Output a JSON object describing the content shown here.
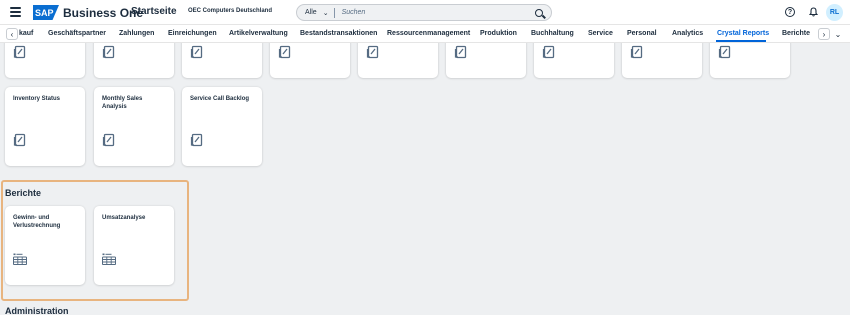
{
  "shell": {
    "logo": "SAP",
    "product": "Business One",
    "home_title": "Startseite",
    "company": "OEC Computers Deutschland",
    "search_scope": "Alle",
    "search_placeholder": "Suchen",
    "help_glyph": "?",
    "avatar": "RL"
  },
  "tabs": [
    {
      "label": "kauf"
    },
    {
      "label": "Geschäftspartner"
    },
    {
      "label": "Zahlungen"
    },
    {
      "label": "Einreichungen"
    },
    {
      "label": "Artikelverwaltung"
    },
    {
      "label": "Bestandstransaktionen"
    },
    {
      "label": "Ressourcenmanagement"
    },
    {
      "label": "Produktion"
    },
    {
      "label": "Buchhaltung"
    },
    {
      "label": "Service"
    },
    {
      "label": "Personal"
    },
    {
      "label": "Analytics"
    },
    {
      "label": "Crystal Reports",
      "active": true
    },
    {
      "label": "Berichte"
    }
  ],
  "crystal_reports": {
    "tiles": [
      {
        "title": "Inventory Status",
        "icon": "document-icon"
      },
      {
        "title": "Monthly Sales Analysis",
        "icon": "document-icon"
      },
      {
        "title": "Service Call Backlog",
        "icon": "document-icon"
      }
    ]
  },
  "berichte": {
    "title": "Berichte",
    "tiles": [
      {
        "title": "Gewinn- und Verlustrechnung",
        "icon": "report-list-icon"
      },
      {
        "title": "Umsatzanalyse",
        "icon": "report-list-icon"
      }
    ]
  },
  "administration": {
    "title": "Administration"
  },
  "colors": {
    "accent": "#0064d9",
    "highlight": "#e8b47f",
    "background": "#eef0f2"
  }
}
